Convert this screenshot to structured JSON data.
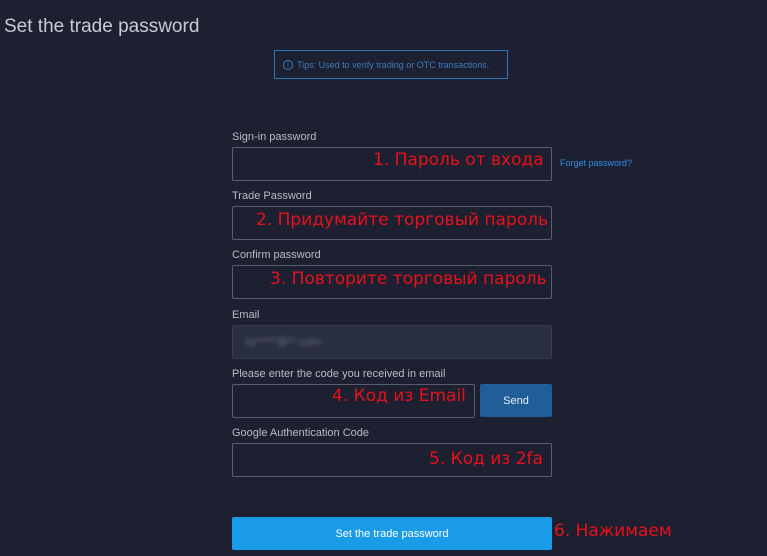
{
  "page": {
    "title": "Set the trade password",
    "tips_icon": "info-icon",
    "tips": "Tips: Used to verify trading or OTC transactions."
  },
  "form": {
    "signin_label": "Sign-in password",
    "forget_link": "Forget password?",
    "trade_label": "Trade Password",
    "confirm_label": "Confirm password",
    "email_label": "Email",
    "email_value": "sy*****@**.com",
    "code_label": "Please enter the code you received in email",
    "send_label": "Send",
    "google_label": "Google Authentication Code",
    "submit_label": "Set the trade password"
  },
  "annotations": {
    "a1": "1. Пароль от входа",
    "a2": "2. Придумайте торговый пароль",
    "a3": "3. Повторите торговый пароль",
    "a4": "4. Код из Email",
    "a5": "5. Код из 2fa",
    "a6": "6. Нажимаем"
  },
  "colors": {
    "background": "#1c2030",
    "accent": "#199be8",
    "annotation": "#e8101a"
  }
}
